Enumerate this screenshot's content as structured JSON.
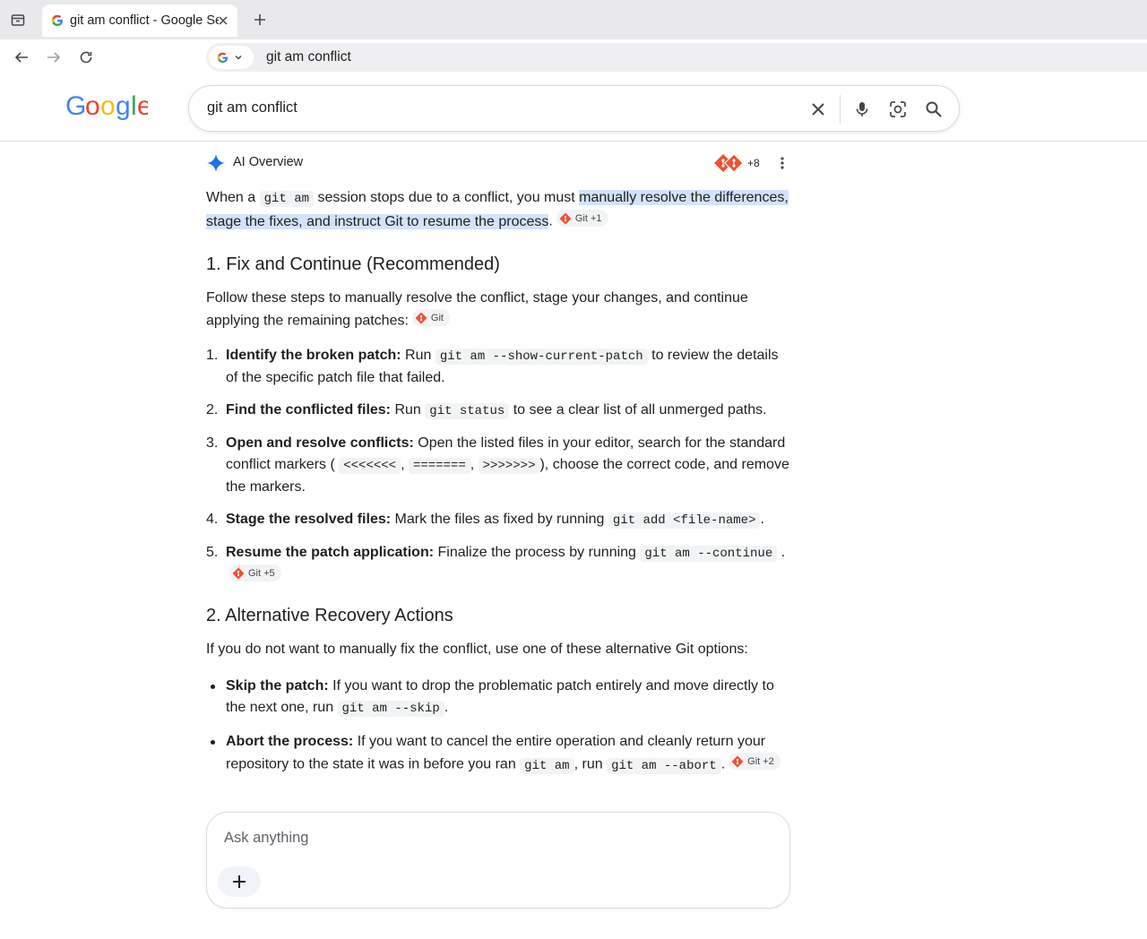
{
  "browser": {
    "tab_title": "git am conflict - Google Search",
    "omnibox_text": "git am conflict"
  },
  "search": {
    "query": "git am conflict"
  },
  "ai_overview": {
    "label": "AI Overview",
    "sources_more": "+8",
    "intro": {
      "part1": "When a ",
      "code1": "git am",
      "part2": " session stops due to a conflict, you must ",
      "highlight": "manually resolve the differences, stage the fixes, and instruct Git to resume the process",
      "part3": ".",
      "chip": "Git +1"
    },
    "section1": {
      "title": "1. Fix and Continue (Recommended)",
      "intro": "Follow these steps to manually resolve the conflict, stage your changes, and continue applying the remaining patches:",
      "intro_chip": "Git",
      "steps": [
        {
          "num": "1.",
          "bold": "Identify the broken patch:",
          "pre": " Run ",
          "code": "git am --show-current-patch",
          "post": " to review the details of the specific patch file that failed."
        },
        {
          "num": "2.",
          "bold": "Find the conflicted files:",
          "pre": " Run ",
          "code": "git status",
          "post": " to see a clear list of all unmerged paths."
        },
        {
          "num": "3.",
          "bold": "Open and resolve conflicts:",
          "pre": " Open the listed files in your editor, search for the standard conflict markers (",
          "code_a": "<<<<<<<",
          "sep1": ", ",
          "code_b": "=======",
          "sep2": ", ",
          "code_c": ">>>>>>>",
          "post": "), choose the correct code, and remove the markers."
        },
        {
          "num": "4.",
          "bold": "Stage the resolved files:",
          "pre": " Mark the files as fixed by running ",
          "code": "git add <file-name>",
          "post": "."
        },
        {
          "num": "5.",
          "bold": "Resume the patch application:",
          "pre": " Finalize the process by running ",
          "code": "git am --continue",
          "post": ".",
          "chip": "Git +5"
        }
      ]
    },
    "section2": {
      "title": "2. Alternative Recovery Actions",
      "intro": "If you do not want to manually fix the conflict, use one of these alternative Git options:",
      "bullets": [
        {
          "bold": "Skip the patch:",
          "pre": " If you want to drop the problematic patch entirely and move directly to the next one, run ",
          "code": "git am --skip",
          "post": "."
        },
        {
          "bold": "Abort the process:",
          "pre": " If you want to cancel the entire operation and cleanly return your repository to the state it was in before you ran ",
          "code": "git am",
          "mid": ", run ",
          "code2": "git am --abort",
          "post": ".",
          "chip": "Git +2"
        }
      ]
    }
  },
  "ask": {
    "placeholder": "Ask anything"
  },
  "colors": {
    "accent_blue": "#1a73e8",
    "highlight": "#d3e3fd",
    "git_orange": "#f05033"
  }
}
